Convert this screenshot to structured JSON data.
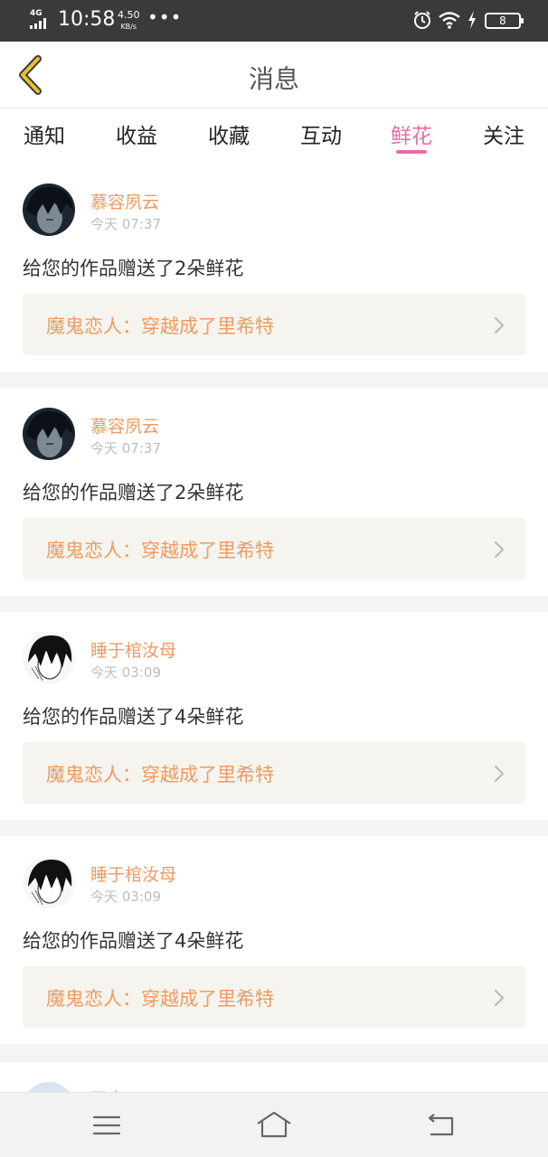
{
  "status_bar": {
    "network": "4G",
    "time": "10:58",
    "speed_value": "4.50",
    "speed_unit": "KB/s",
    "more": "•••",
    "battery": "8"
  },
  "header": {
    "title": "消息",
    "back_icon": "chevron-left-icon"
  },
  "tabs": [
    {
      "label": "通知",
      "active": false
    },
    {
      "label": "收益",
      "active": false
    },
    {
      "label": "收藏",
      "active": false
    },
    {
      "label": "互动",
      "active": false
    },
    {
      "label": "鲜花",
      "active": true
    },
    {
      "label": "关注",
      "active": false
    }
  ],
  "messages": [
    {
      "user": "慕容夙云",
      "time": "今天 07:37",
      "text": "给您的作品赠送了2朵鲜花",
      "work": "魔鬼恋人：穿越成了里希特"
    },
    {
      "user": "慕容夙云",
      "time": "今天 07:37",
      "text": "给您的作品赠送了2朵鲜花",
      "work": "魔鬼恋人：穿越成了里希特"
    },
    {
      "user": "睡于棺汝母",
      "time": "今天 03:09",
      "text": "给您的作品赠送了4朵鲜花",
      "work": "魔鬼恋人：穿越成了里希特"
    },
    {
      "user": "睡于棺汝母",
      "time": "今天 03:09",
      "text": "给您的作品赠送了4朵鲜花",
      "work": "魔鬼恋人：穿越成了里希特"
    }
  ],
  "partial_item": {
    "user": "四安"
  },
  "colors": {
    "accent": "#e36fa7",
    "name": "#ef9b62",
    "back_icon": "#e8c228",
    "work_bg": "#f5f4ee"
  },
  "nav": {
    "menu_icon": "menu-icon",
    "home_icon": "home-icon",
    "back_icon": "back-arrow-icon"
  }
}
